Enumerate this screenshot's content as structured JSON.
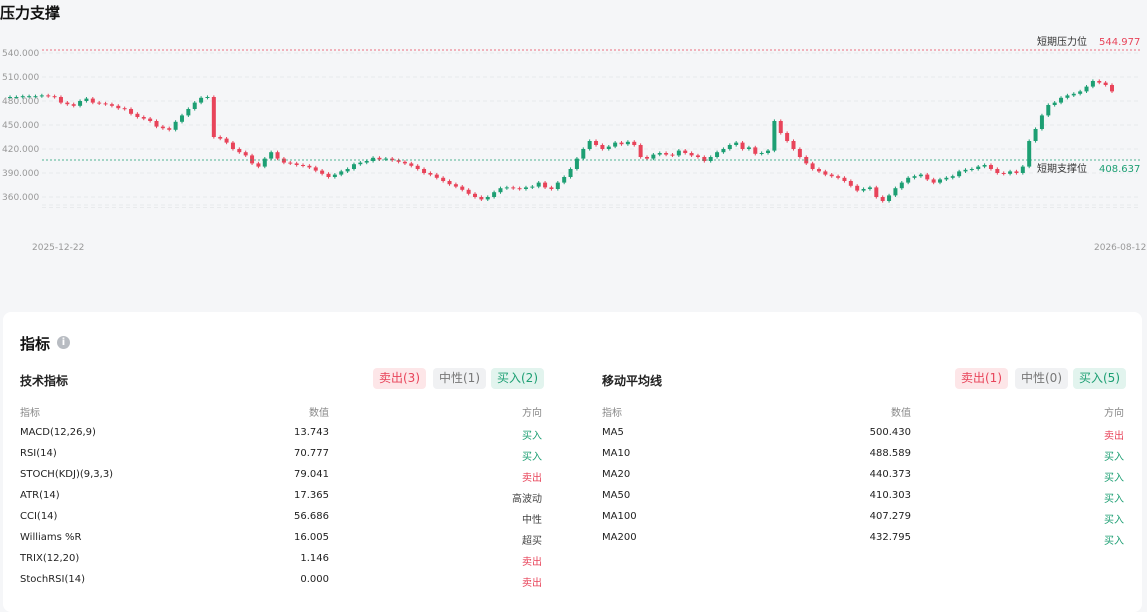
{
  "page_title": "压力支撑",
  "chart": {
    "start_date": "2025-12-22",
    "end_date": "2026-08-12",
    "resistance_label": "短期压力位",
    "resistance_value": "544.977",
    "support_label": "短期支撑位",
    "support_value": "408.637",
    "y_ticks": [
      "540.000",
      "510.000",
      "480.000",
      "450.000",
      "420.000",
      "390.000",
      "360.000"
    ],
    "colors": {
      "up": "#1d9f73",
      "down": "#e8445a",
      "grid": "#e3e5e8"
    }
  },
  "chart_data": {
    "type": "candlestick",
    "x_start": "2025-12-22",
    "x_end": "2026-08-12",
    "ylim": [
      345,
      552
    ],
    "y_ticks": [
      540,
      510,
      480,
      450,
      420,
      390,
      360
    ],
    "resistance": 544.977,
    "support": 408.637,
    "grid": true,
    "closes": [
      485,
      485,
      486,
      486,
      486,
      487,
      486,
      485,
      478,
      476,
      474,
      480,
      483,
      478,
      477,
      476,
      474,
      471,
      470,
      464,
      460,
      458,
      455,
      448,
      446,
      444,
      454,
      462,
      470,
      478,
      484,
      485,
      435,
      433,
      428,
      420,
      416,
      412,
      402,
      398,
      408,
      416,
      408,
      403,
      402,
      400,
      399,
      397,
      393,
      389,
      385,
      388,
      392,
      395,
      401,
      403,
      405,
      409,
      407,
      408,
      406,
      404,
      402,
      399,
      395,
      390,
      388,
      384,
      380,
      376,
      373,
      369,
      364,
      360,
      357,
      360,
      366,
      371,
      372,
      371,
      370,
      372,
      373,
      378,
      372,
      370,
      378,
      385,
      395,
      408,
      420,
      430,
      425,
      420,
      423,
      428,
      426,
      429,
      425,
      410,
      408,
      413,
      415,
      413,
      412,
      418,
      415,
      412,
      410,
      405,
      410,
      416,
      420,
      425,
      428,
      420,
      422,
      414,
      415,
      418,
      455,
      440,
      430,
      420,
      410,
      402,
      395,
      392,
      388,
      386,
      384,
      380,
      374,
      368,
      370,
      372,
      360,
      355,
      362,
      371,
      378,
      384,
      386,
      388,
      382,
      378,
      382,
      384,
      386,
      392,
      394,
      395,
      398,
      400,
      395,
      390,
      389,
      392,
      390,
      398,
      430,
      445,
      462,
      475,
      478,
      484,
      487,
      489,
      492,
      498,
      505,
      503,
      500,
      492
    ]
  },
  "indicators": {
    "title": "指标",
    "info_icon": "info-icon",
    "technical": {
      "title": "技术指标",
      "sell_label": "卖出(3)",
      "neutral_label": "中性(1)",
      "buy_label": "买入(2)",
      "headers": {
        "name": "指标",
        "value": "数值",
        "direction": "方向"
      },
      "rows": [
        {
          "name": "MACD(12,26,9)",
          "value": "13.743",
          "direction": "买入",
          "kind": "buy"
        },
        {
          "name": "RSI(14)",
          "value": "70.777",
          "direction": "买入",
          "kind": "buy"
        },
        {
          "name": "STOCH(KDJ)(9,3,3)",
          "value": "79.041",
          "direction": "卖出",
          "kind": "sell"
        },
        {
          "name": "ATR(14)",
          "value": "17.365",
          "direction": "高波动",
          "kind": "neutral"
        },
        {
          "name": "CCI(14)",
          "value": "56.686",
          "direction": "中性",
          "kind": "neutral"
        },
        {
          "name": "Williams %R",
          "value": "16.005",
          "direction": "超买",
          "kind": "neutral"
        },
        {
          "name": "TRIX(12,20)",
          "value": "1.146",
          "direction": "卖出",
          "kind": "sell"
        },
        {
          "name": "StochRSI(14)",
          "value": "0.000",
          "direction": "卖出",
          "kind": "sell"
        }
      ]
    },
    "moving_average": {
      "title": "移动平均线",
      "sell_label": "卖出(1)",
      "neutral_label": "中性(0)",
      "buy_label": "买入(5)",
      "headers": {
        "name": "指标",
        "value": "数值",
        "direction": "方向"
      },
      "rows": [
        {
          "name": "MA5",
          "value": "500.430",
          "direction": "卖出",
          "kind": "sell"
        },
        {
          "name": "MA10",
          "value": "488.589",
          "direction": "买入",
          "kind": "buy"
        },
        {
          "name": "MA20",
          "value": "440.373",
          "direction": "买入",
          "kind": "buy"
        },
        {
          "name": "MA50",
          "value": "410.303",
          "direction": "买入",
          "kind": "buy"
        },
        {
          "name": "MA100",
          "value": "407.279",
          "direction": "买入",
          "kind": "buy"
        },
        {
          "name": "MA200",
          "value": "432.795",
          "direction": "买入",
          "kind": "buy"
        }
      ]
    }
  }
}
